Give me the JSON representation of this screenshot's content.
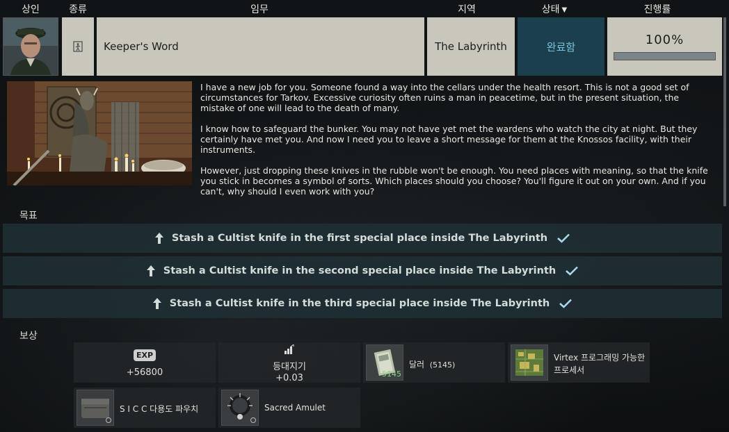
{
  "header": {
    "trader": "상인",
    "type": "종류",
    "quest": "임무",
    "location": "지역",
    "status": "상태",
    "progress": "진행률"
  },
  "quest": {
    "name": "Keeper's Word",
    "location": "The Labyrinth",
    "status": "완료함",
    "progress_text": "100%",
    "progress": 1.0
  },
  "description": [
    "I have a new job for you. Someone found a way into the cellars under the health resort. This is not a good set of circumstances for Tarkov. Excessive curiosity often ruins a man in peacetime, but in the present situation, the mistake of one will lead to the death of many.",
    "I know how to safeguard the bunker. You may not have yet met the wardens who watch the city at night. But they certainly have met you. And now I need you to leave a short message for them at the Knossos facility, with their instruments.",
    "However, just dropping these knives in the rubble won't be enough. You need places with meaning, so that the knife you stick in becomes a symbol of sorts. Which places should you choose? You'll figure it out on your own. And if you can't, why should I even work with you?"
  ],
  "objectives": {
    "title": "목표",
    "items": [
      "Stash a Cultist knife in the first special place inside The Labyrinth",
      "Stash a Cultist knife in the second special place inside The Labyrinth",
      "Stash a Cultist knife in the third special place inside The Labyrinth"
    ]
  },
  "rewards": {
    "title": "보상",
    "exp_badge": "EXP",
    "exp_value": "+56800",
    "standing_label": "등대지기",
    "standing_value": "+0.03",
    "dollars_label": "달러",
    "dollars_count": "(5145)",
    "dollars_stack": "5145",
    "processor_label_1": "Virtex 프로그래밍 가능한",
    "processor_label_2": "프로세서",
    "sicc_label": "S I C C 다용도 파우치",
    "amulet_label": "Sacred Amulet"
  },
  "colors": {
    "status_bg": "#1c3f4e",
    "status_text": "#7dc1de",
    "check": "#a8d8ec",
    "objective_bg": "#20303a"
  }
}
